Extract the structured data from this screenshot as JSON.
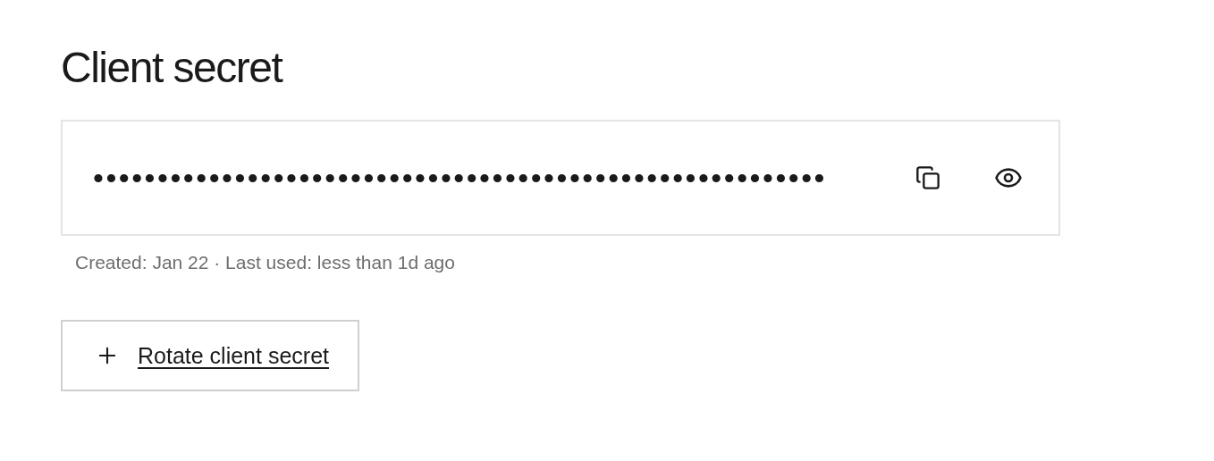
{
  "title": "Client secret",
  "secret": {
    "value": "•••••••••••••••••••••••••••••••••••••••••••••••••••••••••",
    "revealed": false
  },
  "meta": "Created: Jan 22 · Last used: less than 1d ago",
  "rotate_button": {
    "label": "Rotate client secret"
  }
}
